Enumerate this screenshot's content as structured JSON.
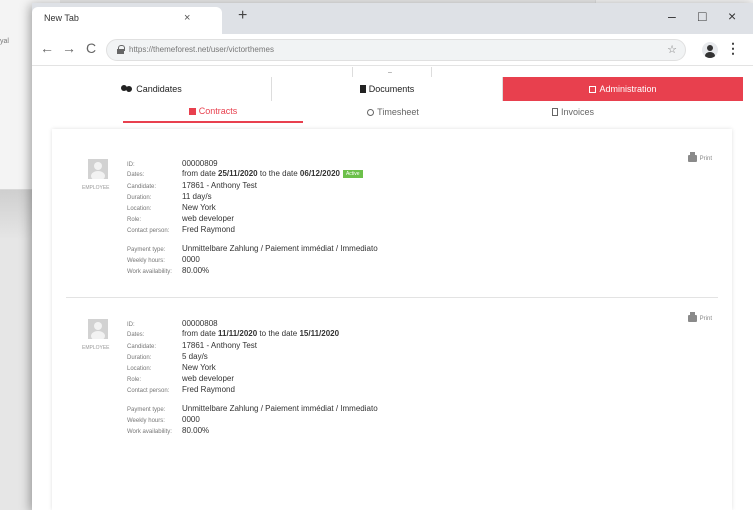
{
  "background": {
    "partial_text": "yal"
  },
  "browser": {
    "tab_title": "New Tab",
    "tab_close": "×",
    "new_tab": "+",
    "win_min": "–",
    "win_max": "□",
    "win_close": "×",
    "back": "←",
    "forward": "→",
    "reload": "C",
    "url": "https://themeforest.net/user/victorthemes",
    "star": "☆",
    "menu": "⋮"
  },
  "nav": {
    "top_mark": "–",
    "candidates": "Candidates",
    "documents": "Documents",
    "administration": "Administration"
  },
  "subnav": {
    "contracts": "Contracts",
    "timesheet": "Timesheet",
    "invoices": "Invoices"
  },
  "colors": {
    "accent": "#e8404e",
    "active_badge": "#6cc04a"
  },
  "contracts": [
    {
      "avatar_caption": "EMPLOYEE",
      "print_label": "Print",
      "id_label": "ID:",
      "id": "00000809",
      "dates_label": "Dates:",
      "dates_from_text": "from date",
      "date_from": "25/11/2020",
      "dates_to_text": "to the date",
      "date_to": "06/12/2020",
      "status": "Active",
      "candidate_label": "Candidate:",
      "candidate": "17861 - Anthony Test",
      "duration_label": "Duration:",
      "duration": "11 day/s",
      "location_label": "Location:",
      "location": "New York",
      "role_label": "Role:",
      "role": "web developer",
      "contact_label": "Contact person:",
      "contact": "Fred Raymond",
      "payment_label": "Payment type:",
      "payment": "Unmittelbare Zahlung / Paiement immédiat / Immediato",
      "weekly_label": "Weekly hours:",
      "weekly": "0000",
      "avail_label": "Work availability:",
      "avail": "80.00%"
    },
    {
      "avatar_caption": "EMPLOYEE",
      "print_label": "Print",
      "id_label": "ID:",
      "id": "00000808",
      "dates_label": "Dates:",
      "dates_from_text": "from date",
      "date_from": "11/11/2020",
      "dates_to_text": "to the date",
      "date_to": "15/11/2020",
      "status": "",
      "candidate_label": "Candidate:",
      "candidate": "17861 - Anthony Test",
      "duration_label": "Duration:",
      "duration": "5 day/s",
      "location_label": "Location:",
      "location": "New York",
      "role_label": "Role:",
      "role": "web developer",
      "contact_label": "Contact person:",
      "contact": "Fred Raymond",
      "payment_label": "Payment type:",
      "payment": "Unmittelbare Zahlung / Paiement immédiat / Immediato",
      "weekly_label": "Weekly hours:",
      "weekly": "0000",
      "avail_label": "Work availability:",
      "avail": "80.00%"
    }
  ]
}
